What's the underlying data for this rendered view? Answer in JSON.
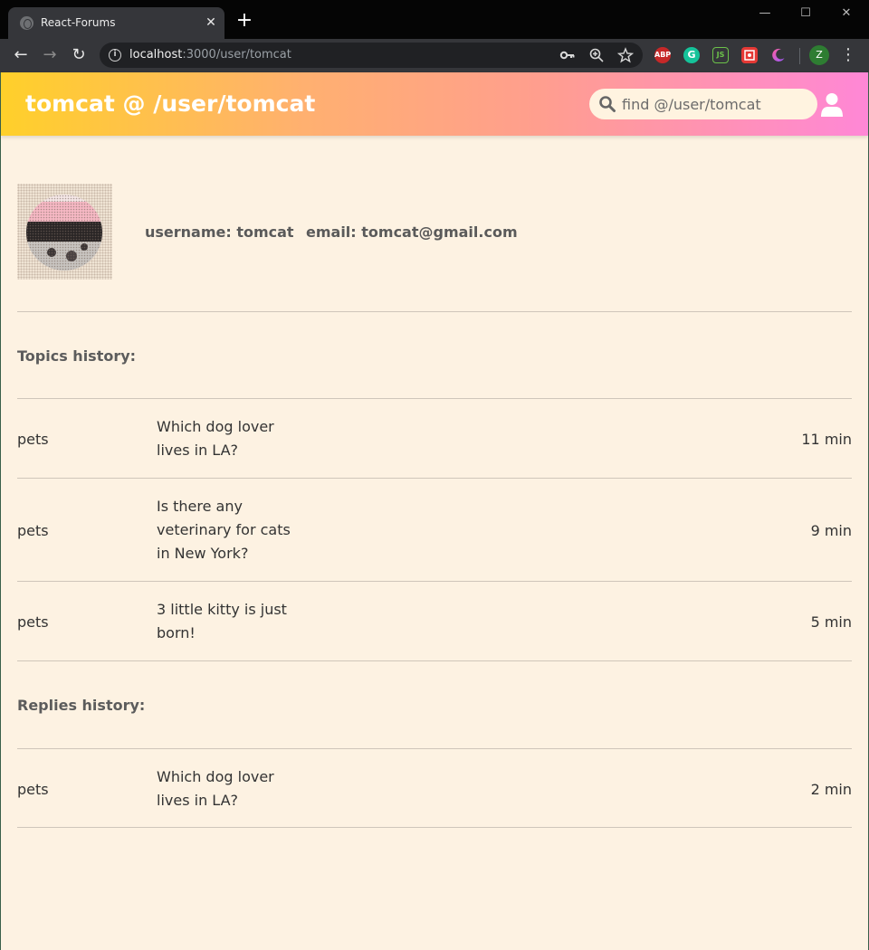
{
  "browser": {
    "tab_title": "React-Forums",
    "tab_close": "✕",
    "new_tab": "+",
    "url_host": "localhost",
    "url_path": ":3000/user/tomcat",
    "profile_initial": "Z",
    "extensions": {
      "abp": "ABP",
      "grammarly": "G",
      "node": "JS"
    }
  },
  "header": {
    "title": "tomcat @ /user/tomcat",
    "search_placeholder": "find @/user/tomcat",
    "gradient_colors": [
      "#ffd02a",
      "#ffb070",
      "#ff9e8e",
      "#ff87d6"
    ]
  },
  "profile": {
    "username_text": "username: tomcat",
    "email_text": "email: tomcat@gmail.com"
  },
  "topics": {
    "title": "Topics history:",
    "rows": [
      {
        "category": "pets",
        "topic": "Which dog lover lives in LA?",
        "time": "11 min"
      },
      {
        "category": "pets",
        "topic": "Is there any veterinary for cats in New York?",
        "time": "9 min"
      },
      {
        "category": "pets",
        "topic": "3 little kitty is just born!",
        "time": "5 min"
      }
    ]
  },
  "replies": {
    "title": "Replies history:",
    "rows": [
      {
        "category": "pets",
        "topic": "Which dog lover lives in LA?",
        "time": "2 min"
      }
    ]
  },
  "colors": {
    "page_background": "#fdf2e2",
    "search_background": "#fff3e0",
    "title_text": "#ffffff"
  }
}
